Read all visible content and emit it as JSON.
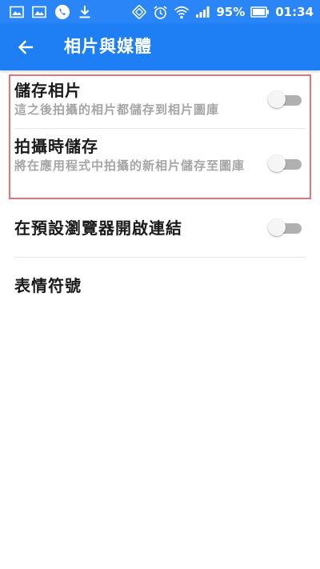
{
  "status_bar": {
    "battery": "95%",
    "time": "01:34",
    "left_icons": [
      "image-icon",
      "image-icon",
      "phone-icon",
      "download-icon"
    ],
    "right_icons": [
      "vibrate-icon",
      "alarm-icon",
      "wifi-icon",
      "signal-icon",
      "battery-icon"
    ]
  },
  "app_bar": {
    "title": "相片與媒體",
    "back_icon": "arrow-left-icon"
  },
  "settings": [
    {
      "title": "儲存相片",
      "subtitle": "這之後拍攝的相片都儲存到相片圖庫",
      "enabled": false
    },
    {
      "title": "拍攝時儲存",
      "subtitle": "將在應用程式中拍攝的新相片儲存至圖庫",
      "enabled": false
    },
    {
      "title": "在預設瀏覽器開啟連結",
      "enabled": false
    },
    {
      "title": "表情符號"
    }
  ],
  "colors": {
    "primary": "#1e7ff5",
    "status_bar": "#2a86f6",
    "highlight_border": "#e4727a",
    "subtitle_text": "#a6a6a6"
  }
}
